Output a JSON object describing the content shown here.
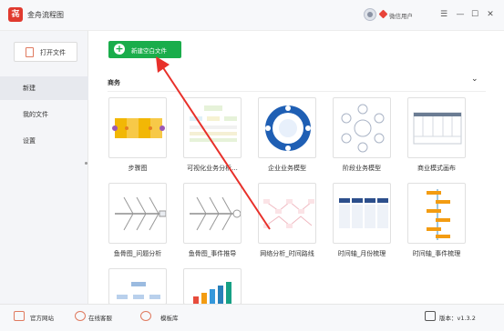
{
  "app": {
    "logo": "㐂",
    "title": "金舟流程图"
  },
  "user": {
    "name": "微信用户"
  },
  "window": {
    "menu": "☰",
    "minimize": "—",
    "maximize": "☐",
    "close": "✕"
  },
  "sidebar": {
    "open_label": "打开文件",
    "items": [
      {
        "label": "新建"
      },
      {
        "label": "我的文件"
      },
      {
        "label": "设置"
      }
    ]
  },
  "main": {
    "new_blank_label": "新建空白文件",
    "section_title": "商务",
    "collapse": "⌄",
    "templates": [
      {
        "label": "步骤图"
      },
      {
        "label": "可视化业务分析..."
      },
      {
        "label": "企业业务模型"
      },
      {
        "label": "阶段业务模型"
      },
      {
        "label": "商业模式画布"
      },
      {
        "label": "鱼骨图_问题分析"
      },
      {
        "label": "鱼骨图_事件推导"
      },
      {
        "label": "网络分析_时间路线"
      },
      {
        "label": "时间轴_月份梳理"
      },
      {
        "label": "时间轴_事件梳理"
      },
      {
        "label": ""
      },
      {
        "label": ""
      }
    ]
  },
  "footer": {
    "website": "官方网站",
    "service": "在线客服",
    "templates": "模板库",
    "version": "版本：v1.3.2"
  },
  "colors": {
    "accent": "#1aad4b",
    "brand": "#e03a2f",
    "arrow": "#e8302a"
  }
}
